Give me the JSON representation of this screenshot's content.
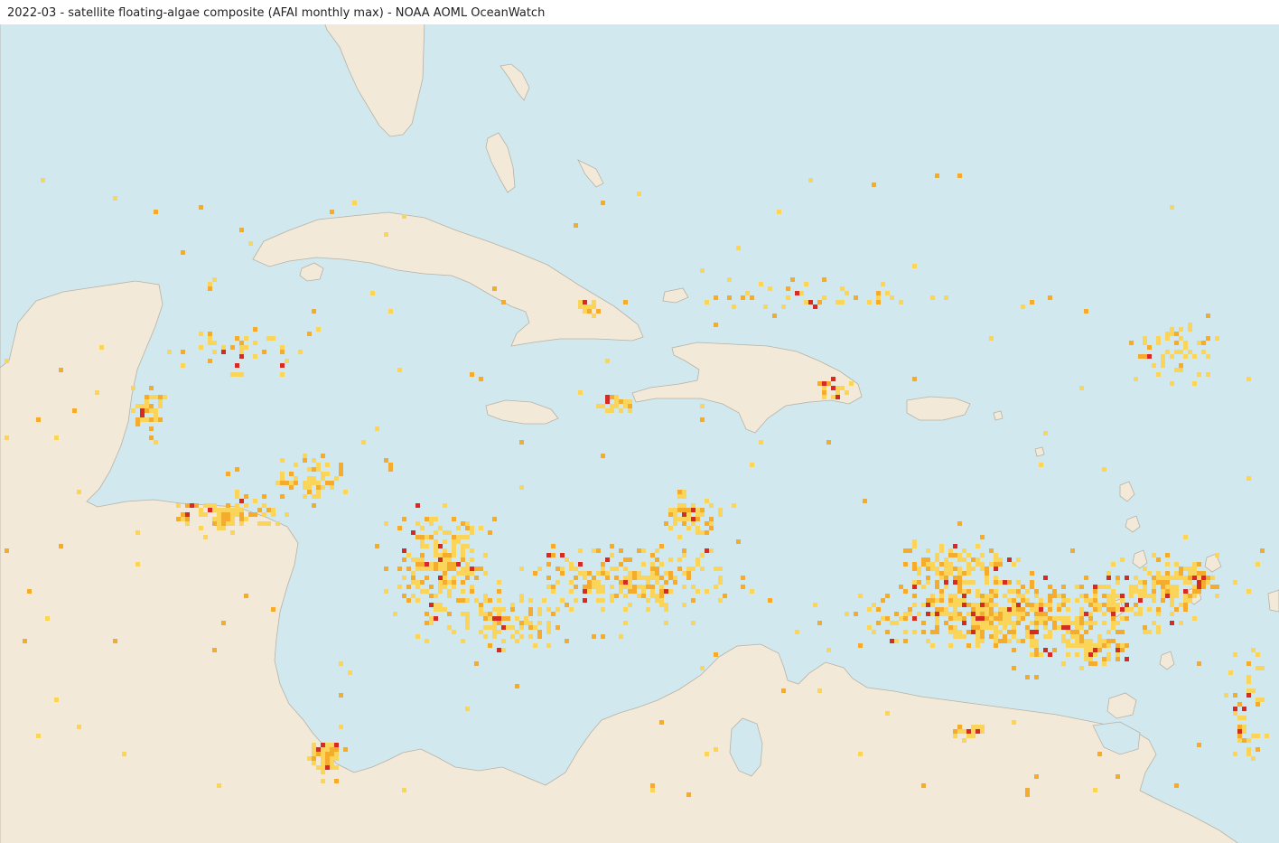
{
  "map": {
    "title": "2022-03 - satellite floating-algae composite (AFAI monthly max) - NOAA AOML OceanWatch",
    "colors": {
      "ocean": "#d1e8ee",
      "land": "#f2e9d9",
      "coast": "#b8b2a4",
      "algae_low": "#fbd55a",
      "algae_mid": "#f5ab2c",
      "algae_high": "#d52b22"
    },
    "icons": [
      "algae-density-cell"
    ]
  }
}
